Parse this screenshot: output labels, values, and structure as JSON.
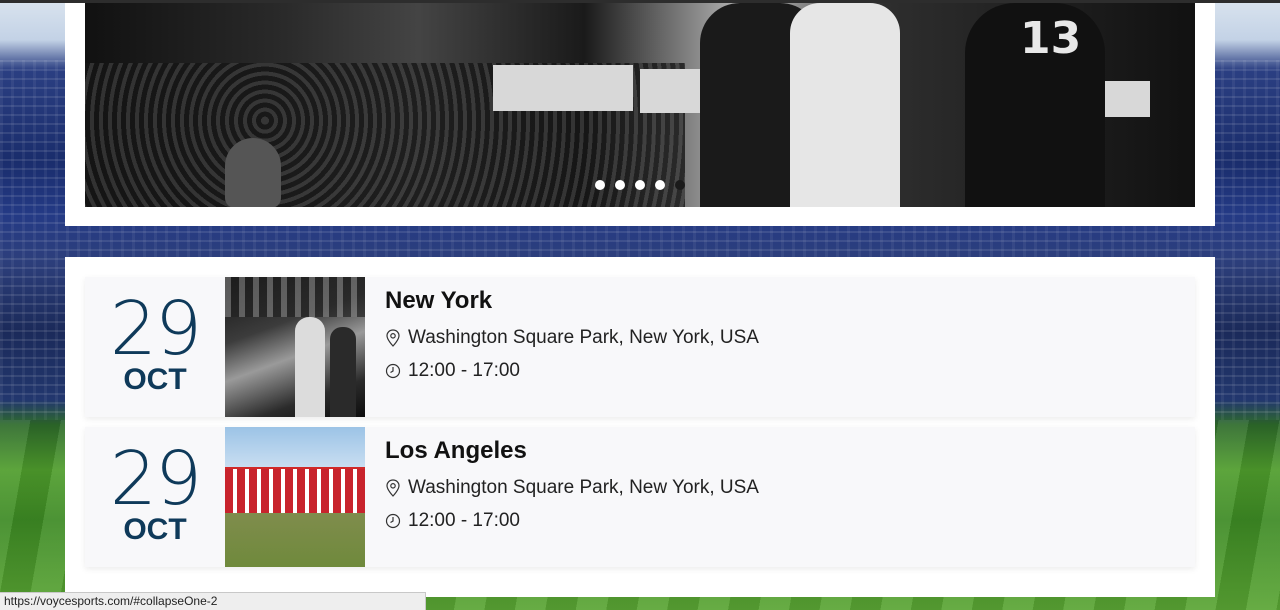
{
  "hero": {
    "jersey_number": "13",
    "carousel": {
      "slide_count": 5,
      "active_indices": [
        0,
        1,
        2,
        3
      ]
    }
  },
  "events": [
    {
      "day": "29",
      "month": "OCT",
      "city": "New York",
      "location": "Washington Square Park, New York, USA",
      "time": "12:00 - 17:00",
      "thumbnail": "basketball-game-bw"
    },
    {
      "day": "29",
      "month": "OCT",
      "city": "Los Angeles",
      "location": "Washington Square Park, New York, USA",
      "time": "12:00 - 17:00",
      "thumbnail": "stadium-field"
    }
  ],
  "icons": {
    "location": "map-pin-icon",
    "time": "clock-icon"
  },
  "status_bar": {
    "url": "https://voycesports.com/#collapseOne-2"
  },
  "colors": {
    "date_text": "#0f3a5a",
    "card_bg": "#f8f8fa",
    "panel_bg": "#ffffff"
  }
}
